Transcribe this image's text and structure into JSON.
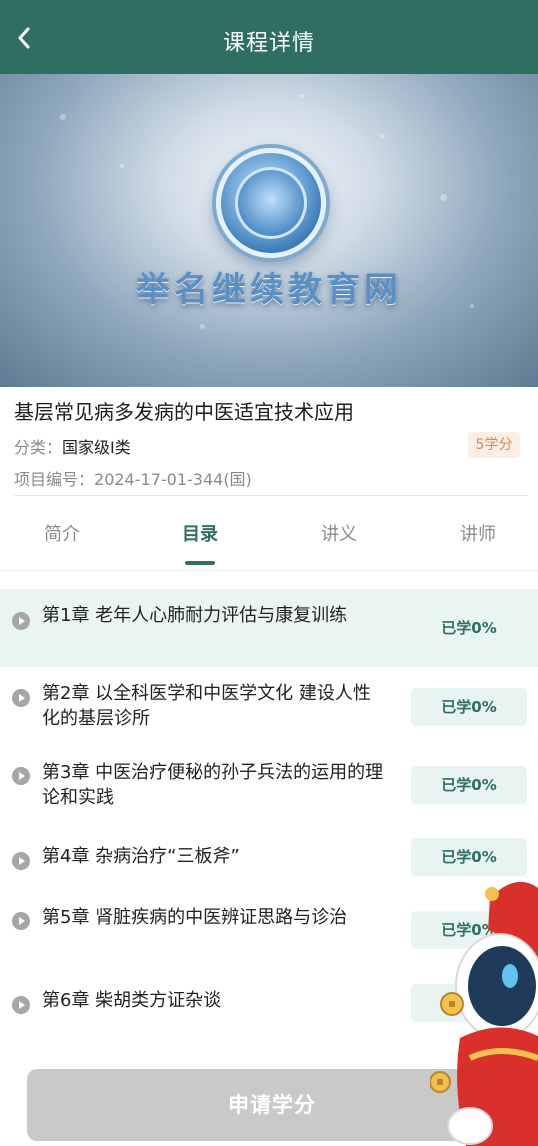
{
  "header": {
    "title": "课程详情",
    "back_icon": "chevron-left-icon"
  },
  "banner": {
    "logo_text": "举名继续教育网"
  },
  "course": {
    "title": "基层常见病多发病的中医适宜技术应用",
    "category_label": "分类：",
    "category_value": "国家级I类",
    "credit": "5学分",
    "project_label": "项目编号：",
    "project_value": "2024-17-01-344(国)"
  },
  "tabs": [
    {
      "label": "简介"
    },
    {
      "label": "目录",
      "active": true
    },
    {
      "label": "讲义"
    },
    {
      "label": "讲师"
    }
  ],
  "chapters": [
    {
      "title": "第1章 老年人心肺耐力评估与康复训练",
      "progress": "已学0%",
      "current": true
    },
    {
      "title": "第2章 以全科医学和中医学文化 建设人性化的基层诊所",
      "progress": "已学0%"
    },
    {
      "title": "第3章 中医治疗便秘的孙子兵法的运用的理论和实践",
      "progress": "已学0%"
    },
    {
      "title": "第4章 杂病治疗“三板斧”",
      "progress": "已学0%"
    },
    {
      "title": "第5章 肾脏疾病的中医辨证思路与诊治",
      "progress": "已学0%"
    },
    {
      "title": "第6章 柴胡类方证杂谈",
      "progress": "已学0%"
    }
  ],
  "footer": {
    "apply_label": "申请学分"
  },
  "colors": {
    "primary": "#2f6f61",
    "progress_bg": "#e8f4f2",
    "current_row_bg": "#e9f5f2",
    "badge_bg": "#fbeee4",
    "badge_text": "#e0874a",
    "button_disabled": "#c9c9c9"
  }
}
